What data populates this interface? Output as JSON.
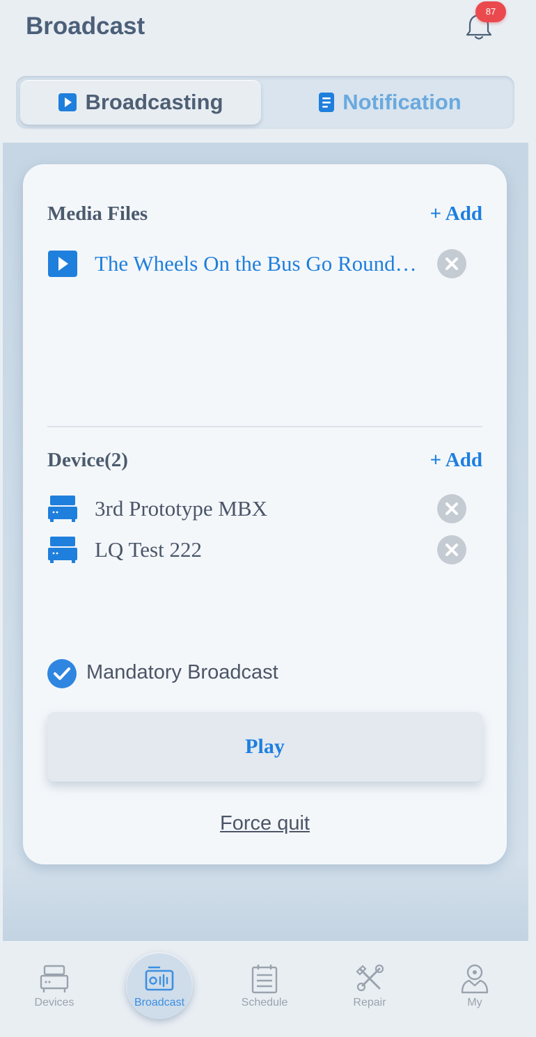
{
  "header": {
    "title": "Broadcast",
    "badge_count": "87"
  },
  "segments": {
    "active": "Broadcasting",
    "inactive": "Notification"
  },
  "media": {
    "title": "Media Files",
    "add_label": "+ Add",
    "items": [
      {
        "name": "The Wheels On the Bus Go Rounds and Rounds"
      }
    ]
  },
  "device": {
    "title": "Device(2)",
    "add_label": "+ Add",
    "items": [
      {
        "name": "3rd Prototype MBX"
      },
      {
        "name": "LQ Test 222"
      }
    ]
  },
  "mandatory": {
    "label": "Mandatory Broadcast",
    "checked": true
  },
  "actions": {
    "play": "Play",
    "force_quit": "Force quit"
  },
  "tabbar": {
    "items": [
      {
        "label": "Devices",
        "icon": "devices-icon"
      },
      {
        "label": "Broadcast",
        "icon": "broadcast-icon",
        "active": true
      },
      {
        "label": "Schedule",
        "icon": "schedule-icon"
      },
      {
        "label": "Repair",
        "icon": "repair-icon"
      },
      {
        "label": "My",
        "icon": "user-icon"
      }
    ]
  },
  "colors": {
    "accent": "#1f7fdc",
    "badge": "#ea4a4e",
    "text": "#4b5f78"
  }
}
